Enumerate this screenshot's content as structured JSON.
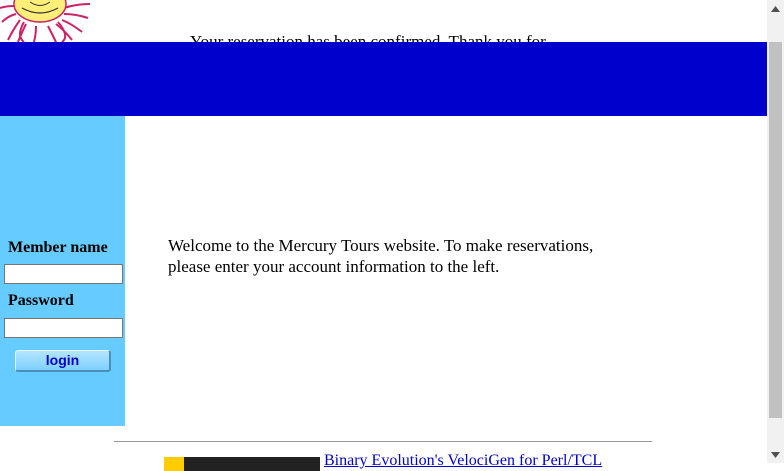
{
  "background_text": "Your reservation has been confirmed. Thank you for",
  "colors": {
    "banner": "#0000cc",
    "sidebar": "#66ccff",
    "link": "#0000cc",
    "button_text": "#0000cc"
  },
  "sidebar": {
    "member_label": "Member name",
    "member_value": "",
    "password_label": "Password",
    "password_value": "",
    "login_label": "login"
  },
  "main": {
    "welcome": "Welcome to the Mercury Tours website. To make reservations, please enter your account information to the left."
  },
  "footer": {
    "link_text": "Binary Evolution's VelociGen for Perl/TCL"
  },
  "icons": {
    "logo": "sun-logo-icon",
    "scroll_up": "scroll-up-arrow-icon",
    "scroll_down": "scroll-down-arrow-icon"
  }
}
